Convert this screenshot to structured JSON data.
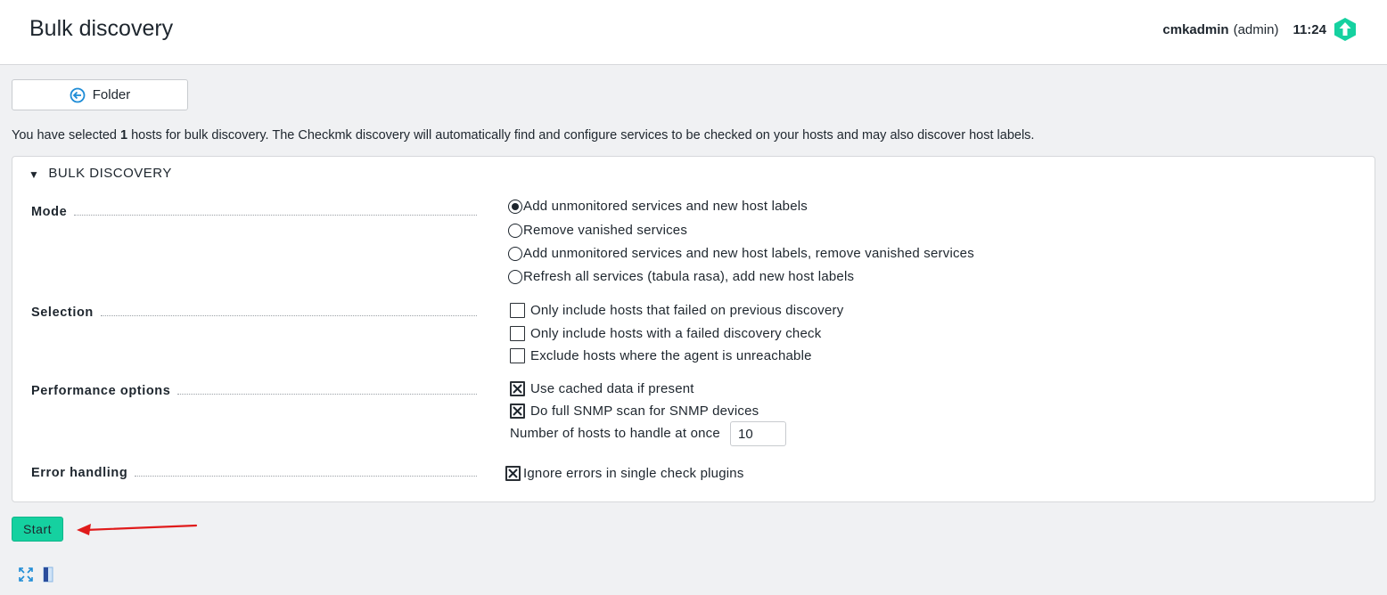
{
  "header": {
    "title": "Bulk discovery",
    "user": "cmkadmin",
    "role": "(admin)",
    "time": "11:24",
    "logo_icon": "checkmk-logo-icon",
    "accent_color": "#15d1a0"
  },
  "folder_button": {
    "label": "Folder",
    "icon": "back-circle-icon"
  },
  "info": {
    "prefix": "You have selected ",
    "count": "1",
    "suffix": " hosts for bulk discovery. The Checkmk discovery will automatically find and configure services to be checked on your hosts and may also discover host labels."
  },
  "panel": {
    "title": "BULK DISCOVERY",
    "mode": {
      "label": "Mode",
      "options": [
        {
          "label": "Add unmonitored services and new host labels",
          "selected": true
        },
        {
          "label": "Remove vanished services",
          "selected": false
        },
        {
          "label": "Add unmonitored services and new host labels, remove vanished services",
          "selected": false
        },
        {
          "label": "Refresh all services (tabula rasa), add new host labels",
          "selected": false
        }
      ]
    },
    "selection": {
      "label": "Selection",
      "options": [
        {
          "label": "Only include hosts that failed on previous discovery",
          "checked": false
        },
        {
          "label": "Only include hosts with a failed discovery check",
          "checked": false
        },
        {
          "label": "Exclude hosts where the agent is unreachable",
          "checked": false
        }
      ]
    },
    "performance": {
      "label": "Performance options",
      "options": [
        {
          "label": "Use cached data if present",
          "checked": true
        },
        {
          "label": "Do full SNMP scan for SNMP devices",
          "checked": true
        }
      ],
      "hosts_label": "Number of hosts to handle at once",
      "hosts_value": "10"
    },
    "error_handling": {
      "label": "Error handling",
      "option": {
        "label": "Ignore errors in single check plugins",
        "checked": true
      }
    }
  },
  "start_button": {
    "label": "Start"
  },
  "footer": {
    "icons": [
      "fullscreen-icon",
      "sidebar-toggle-icon"
    ]
  }
}
